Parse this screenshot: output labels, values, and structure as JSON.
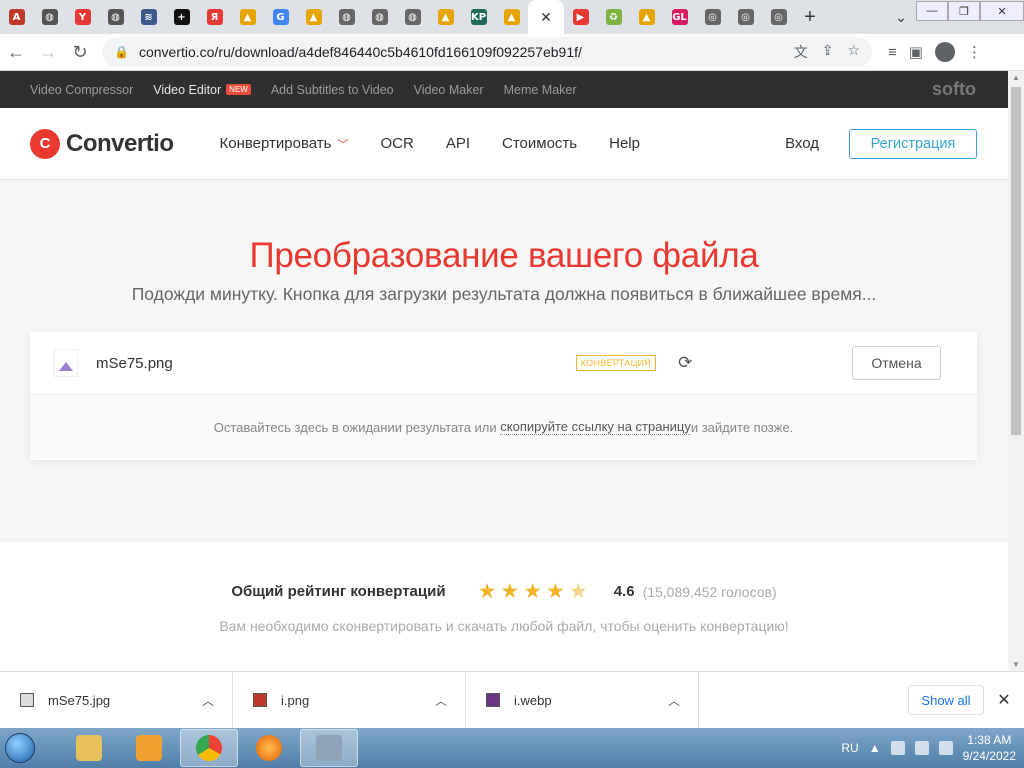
{
  "browser": {
    "tabs": [
      {
        "icon": "abp-icon",
        "glyph": "A",
        "color": "#c0392b"
      },
      {
        "icon": "globe-icon",
        "glyph": "◍",
        "color": "#555555"
      },
      {
        "icon": "yandex-icon",
        "glyph": "Y",
        "color": "#e53935"
      },
      {
        "icon": "globe-icon",
        "glyph": "◍",
        "color": "#555555"
      },
      {
        "icon": "chart-icon",
        "glyph": "≋",
        "color": "#3b5a8a"
      },
      {
        "icon": "plus-circle-icon",
        "glyph": "+",
        "color": "#111111"
      },
      {
        "icon": "yandex-icon",
        "glyph": "Я",
        "color": "#e53935"
      },
      {
        "icon": "image-icon",
        "glyph": "▲",
        "color": "#e6a400"
      },
      {
        "icon": "google-icon",
        "glyph": "G",
        "color": "#4285f4"
      },
      {
        "icon": "image-icon",
        "glyph": "▲",
        "color": "#e6a400"
      },
      {
        "icon": "globe-icon",
        "glyph": "◍",
        "color": "#666666"
      },
      {
        "icon": "globe-icon",
        "glyph": "◍",
        "color": "#666666"
      },
      {
        "icon": "globe-icon",
        "glyph": "◍",
        "color": "#666666"
      },
      {
        "icon": "image-icon",
        "glyph": "▲",
        "color": "#e6a400"
      },
      {
        "icon": "kp-icon",
        "glyph": "KP",
        "color": "#1e6b5c"
      },
      {
        "icon": "image-icon",
        "glyph": "▲",
        "color": "#e6a400"
      }
    ],
    "active_tab_close": "✕",
    "tabs_after": [
      {
        "icon": "youtube-icon",
        "glyph": "▶",
        "color": "#e53935"
      },
      {
        "icon": "recycle-icon",
        "glyph": "♻",
        "color": "#7cb342"
      },
      {
        "icon": "image-icon",
        "glyph": "▲",
        "color": "#e6a400"
      },
      {
        "icon": "gl-icon",
        "glyph": "GL",
        "color": "#d81b60"
      },
      {
        "icon": "chrome-icon",
        "glyph": "◎",
        "color": "#666666"
      },
      {
        "icon": "chrome-icon",
        "glyph": "◎",
        "color": "#666666"
      },
      {
        "icon": "chrome-icon",
        "glyph": "◎",
        "color": "#666666"
      }
    ],
    "new_tab": "+",
    "url": "convertio.co/ru/download/a4def846440c5b4610fd166109f092257eb91f/"
  },
  "topstrip": {
    "links": [
      "Video Compressor",
      "Video Editor",
      "Add Subtitles to Video",
      "Video Maker",
      "Meme Maker"
    ],
    "new_badge": "NEW",
    "brand": "softo"
  },
  "header": {
    "logo_mark": "C",
    "logo_text": "Convertio",
    "nav": [
      "Конвертировать",
      "OCR",
      "API",
      "Стоимость",
      "Help"
    ],
    "login": "Вход",
    "register": "Регистрация"
  },
  "hero": {
    "title": "Преобразование вашего файла",
    "subtitle": "Подожди минутку. Кнопка для загрузки результата должна появиться в ближайшее время..."
  },
  "file": {
    "name": "mSe75.png",
    "status": "КОНВЕРТАЦИЯ",
    "cancel": "Отмена",
    "info_before": "Оставайтесь здесь в ожидании результата или ",
    "info_link": "скопируйте ссылку на страницу",
    "info_after": " и зайдите позже."
  },
  "rating": {
    "label": "Общий рейтинг конвертаций",
    "score": "4.6",
    "stars_value": 4.6,
    "votes": "(15,089,452 голосов)",
    "note": "Вам необходимо сконвертировать и скачать любой файл, чтобы оценить конвертацию!"
  },
  "downloads": {
    "items": [
      "mSe75.jpg",
      "i.png",
      "i.webp"
    ],
    "show_all": "Show all"
  },
  "taskbar": {
    "lang": "RU",
    "time": "1:38 AM",
    "date": "9/24/2022"
  }
}
